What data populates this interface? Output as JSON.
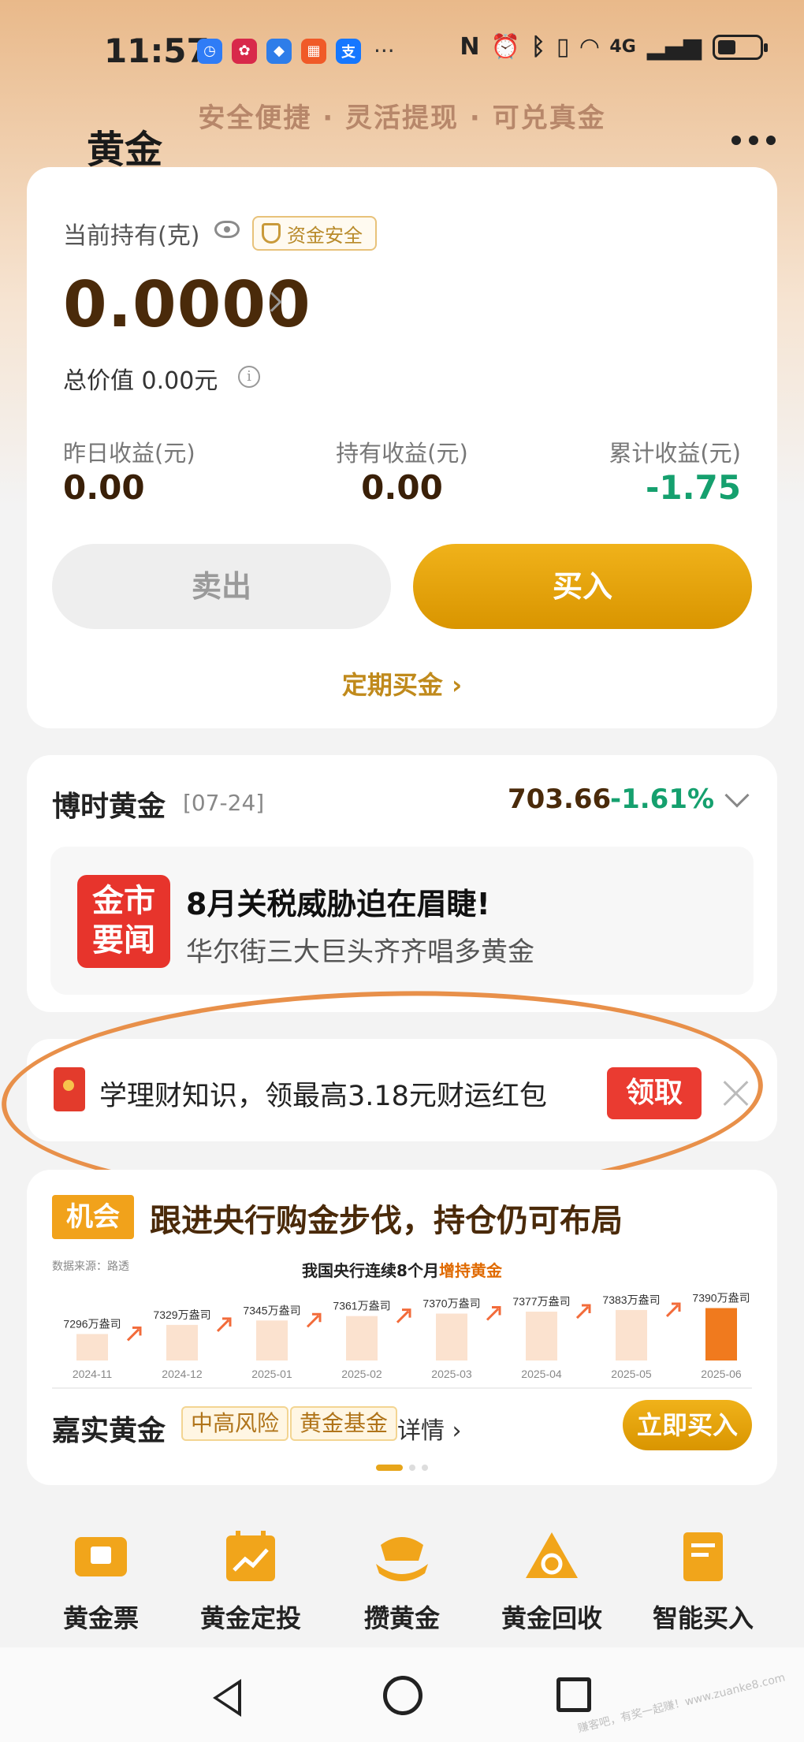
{
  "status_bar": {
    "time": "11:57",
    "network": "4G",
    "apps": [
      {
        "icon": "clock-app-icon",
        "color": "#2f7cf6",
        "glyph": "◷"
      },
      {
        "icon": "huawei-app-icon",
        "color": "#d8294a",
        "glyph": "✿"
      },
      {
        "icon": "shield-app-icon",
        "color": "#2e7de9",
        "glyph": "◆"
      },
      {
        "icon": "grid-app-icon",
        "color": "#f05a28",
        "glyph": "▦"
      },
      {
        "icon": "alipay-app-icon",
        "color": "#1677ff",
        "glyph": "支"
      }
    ],
    "more": "···"
  },
  "header": {
    "slogan": "安全便捷 · 灵活提现 · 可兑真金",
    "title": "黄金"
  },
  "holding": {
    "label": "当前持有(克)",
    "safety_tag": "资金安全",
    "amount": "0.0000",
    "total_value": "总价值  0.00元",
    "stats": [
      {
        "label": "昨日收益(元)",
        "value": "0.00",
        "color": "#3a2008"
      },
      {
        "label": "持有收益(元)",
        "value": "0.00",
        "color": "#3a2008"
      },
      {
        "label": "累计收益(元)",
        "value": "-1.75",
        "color": "#15a06e"
      }
    ],
    "sell_label": "卖出",
    "buy_label": "买入",
    "regular_buy": "定期买金 ›"
  },
  "fund": {
    "name": "博时黄金",
    "date": "[07-24]",
    "price": "703.66",
    "change": "-1.61%",
    "news_logo": "金市要闻",
    "news_title": "8月关税威胁迫在眉睫!",
    "news_subtitle": "华尔街三大巨头齐齐唱多黄金"
  },
  "promo": {
    "text": "学理财知识，领最高3.18元财运红包",
    "claim_label": "领取"
  },
  "opportunity": {
    "badge": "机会",
    "title": "跟进央行购金步伐，持仓仍可布局",
    "fund_name": "嘉实黄金",
    "tags": [
      "中高风险",
      "黄金基金"
    ],
    "detail": "详情 ›",
    "buy_now": "立即买入"
  },
  "chart_data": {
    "type": "bar",
    "title_prefix": "我国央行连续8个月",
    "title_highlight": "增持黄金",
    "source": "数据来源：路透",
    "categories": [
      "2024-11",
      "2024-12",
      "2025-01",
      "2025-02",
      "2025-03",
      "2025-04",
      "2025-05",
      "2025-06"
    ],
    "values": [
      7296,
      7329,
      7345,
      7361,
      7370,
      7377,
      7383,
      7390
    ],
    "value_labels": [
      "7296万盎司",
      "7329万盎司",
      "7345万盎司",
      "7361万盎司",
      "7370万盎司",
      "7377万盎司",
      "7383万盎司",
      "7390万盎司"
    ],
    "ylim": [
      7200,
      7400
    ],
    "colors": {
      "bar": "#fbe2cf",
      "last_bar": "#f07a1e",
      "arrow": "#f26b3a"
    }
  },
  "entries": [
    {
      "icon": "gold-ticket-icon",
      "label": "黄金票"
    },
    {
      "icon": "calendar-chart-icon",
      "label": "黄金定投"
    },
    {
      "icon": "savings-icon",
      "label": "攒黄金"
    },
    {
      "icon": "recycle-icon",
      "label": "黄金回收"
    },
    {
      "icon": "document-icon",
      "label": "智能买入"
    }
  ],
  "watermark": "赚客吧，有奖一起赚！www.zuanke8.com",
  "colors": {
    "accent": "#e7a51a",
    "down_green": "#15a06e",
    "brand_brown": "#4a2a0a"
  }
}
